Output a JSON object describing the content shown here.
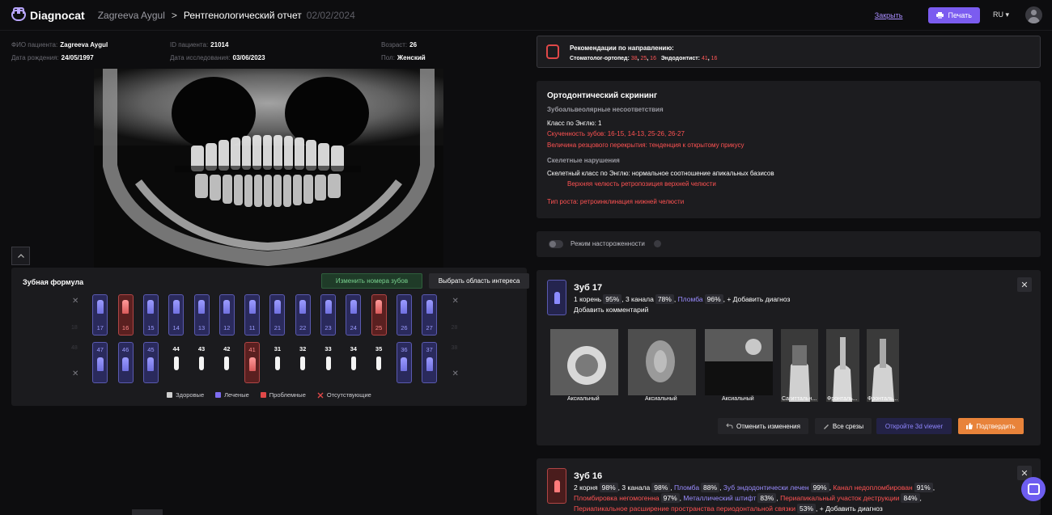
{
  "header": {
    "app_name": "Diagnocat",
    "user": "Zagreeva Aygul",
    "separator": ">",
    "title": "Рентгенологический отчет",
    "date": "02/02/2024",
    "close": "Закрыть",
    "print": "Печать",
    "lang": "RU",
    "lang_caret": "▾"
  },
  "patient": {
    "name_label": "ФИО пациента:",
    "name": "Zagreeva Aygul",
    "id_label": "ID пациента:",
    "id": "21014",
    "age_label": "Возраст:",
    "age": "26",
    "dob_label": "Дата рождения:",
    "dob": "24/05/1997",
    "study_label": "Дата исследования:",
    "study_date": "03/06/2023",
    "sex_label": "Пол:",
    "sex": "Женский"
  },
  "formula": {
    "title": "Зубная формула",
    "renumber": "Изменить номера зубов",
    "roi": "Выбрать область интереса",
    "upper": [
      {
        "n": "18",
        "s": "absent"
      },
      {
        "n": "17",
        "s": "treated"
      },
      {
        "n": "16",
        "s": "problem"
      },
      {
        "n": "15",
        "s": "treated"
      },
      {
        "n": "14",
        "s": "treated"
      },
      {
        "n": "13",
        "s": "treated"
      },
      {
        "n": "12",
        "s": "treated"
      },
      {
        "n": "11",
        "s": "treated"
      },
      {
        "n": "21",
        "s": "treated"
      },
      {
        "n": "22",
        "s": "treated"
      },
      {
        "n": "23",
        "s": "treated"
      },
      {
        "n": "24",
        "s": "treated"
      },
      {
        "n": "25",
        "s": "problem"
      },
      {
        "n": "26",
        "s": "treated"
      },
      {
        "n": "27",
        "s": "treated"
      },
      {
        "n": "28",
        "s": "absent"
      }
    ],
    "lower": [
      {
        "n": "48",
        "s": "absent"
      },
      {
        "n": "47",
        "s": "treated"
      },
      {
        "n": "46",
        "s": "treated"
      },
      {
        "n": "45",
        "s": "treated"
      },
      {
        "n": "44",
        "s": "healthy"
      },
      {
        "n": "43",
        "s": "healthy"
      },
      {
        "n": "42",
        "s": "healthy"
      },
      {
        "n": "41",
        "s": "problem"
      },
      {
        "n": "31",
        "s": "healthy"
      },
      {
        "n": "32",
        "s": "healthy"
      },
      {
        "n": "33",
        "s": "healthy"
      },
      {
        "n": "34",
        "s": "healthy"
      },
      {
        "n": "35",
        "s": "healthy"
      },
      {
        "n": "36",
        "s": "treated"
      },
      {
        "n": "37",
        "s": "treated"
      },
      {
        "n": "38",
        "s": "absent"
      }
    ],
    "legend": {
      "healthy": "Здоровые",
      "treated": "Леченые",
      "problem": "Проблемные",
      "absent": "Отсутствующие"
    }
  },
  "recommendations": {
    "title": "Рекомендации по направлению:",
    "ortho_label": "Стоматолог-ортопед:",
    "ortho_teeth": [
      "38",
      "25",
      "16"
    ],
    "endo_label": "Эндодонтист:",
    "endo_teeth": [
      "41",
      "16"
    ]
  },
  "ortho": {
    "title": "Ортодонтический скрининг",
    "dental_head": "Зубоальвеолярные несоответствия",
    "angle": "Класс по Энглю: 1",
    "crowding": "Скученность зубов: 16-15, 14-13, 25-26, 26-27",
    "overbite": "Величина резцового перекрытия: тенденция к открытому прикусу",
    "skeletal_head": "Скелетные нарушения",
    "skeletal_class": "Скелетный класс по Энглю: нормальное соотношение апикальных базисов",
    "maxilla": "Верхняя челюсть ретропозиция верхней челюсти",
    "growth": "Тип роста: ретроинклинация нижней челюсти"
  },
  "alert": {
    "label": "Режим настороженности"
  },
  "tooth17": {
    "title": "Зуб 17",
    "roots": "1 корень",
    "roots_pct": "95%",
    "canals": "3 канала",
    "canals_pct": "78%",
    "filling": "Пломба",
    "filling_pct": "96%",
    "add_diag": "+ Добавить диагноз",
    "add_comment": "Добавить комментарий",
    "slices": [
      "Аксиальный",
      "Аксиальный",
      "Аксиальный",
      "Сагиттальн...",
      "Фронталь...",
      "Фронталь..."
    ],
    "cancel": "Отменить изменения",
    "all_slices": "Все срезы",
    "open3d": "Откройте 3d viewer",
    "confirm": "Подтвердить"
  },
  "tooth16": {
    "title": "Зуб 16",
    "roots": "2 корня",
    "roots_pct": "98%",
    "canals": "3 канала",
    "canals_pct": "98%",
    "filling": "Пломба",
    "filling_pct": "88%",
    "endo": "Зуб эндодонтически лечен",
    "endo_pct": "99%",
    "underfill": "Канал недопломбирован",
    "underfill_pct": "91%",
    "inhomog": "Пломбировка негомогенна",
    "inhomog_pct": "97%",
    "post": "Металлический штифт",
    "post_pct": "83%",
    "lesion": "Периапикальный участок деструкции",
    "lesion_pct": "84%",
    "widening": "Периапикальное расширение пространства периодонтальной связки",
    "widening_pct": "53%",
    "add_diag": "+ Добавить диагноз"
  },
  "colors": {
    "accent": "#7b5cf0",
    "problem": "#ff5252",
    "treated": "#5a5ab0",
    "confirm": "#e8833a"
  },
  "icons": [
    "logo-icon",
    "print-icon",
    "avatar-icon",
    "chevron-up-icon",
    "close-icon",
    "undo-icon",
    "scalpel-icon",
    "thumbs-up-icon",
    "chat-icon"
  ]
}
